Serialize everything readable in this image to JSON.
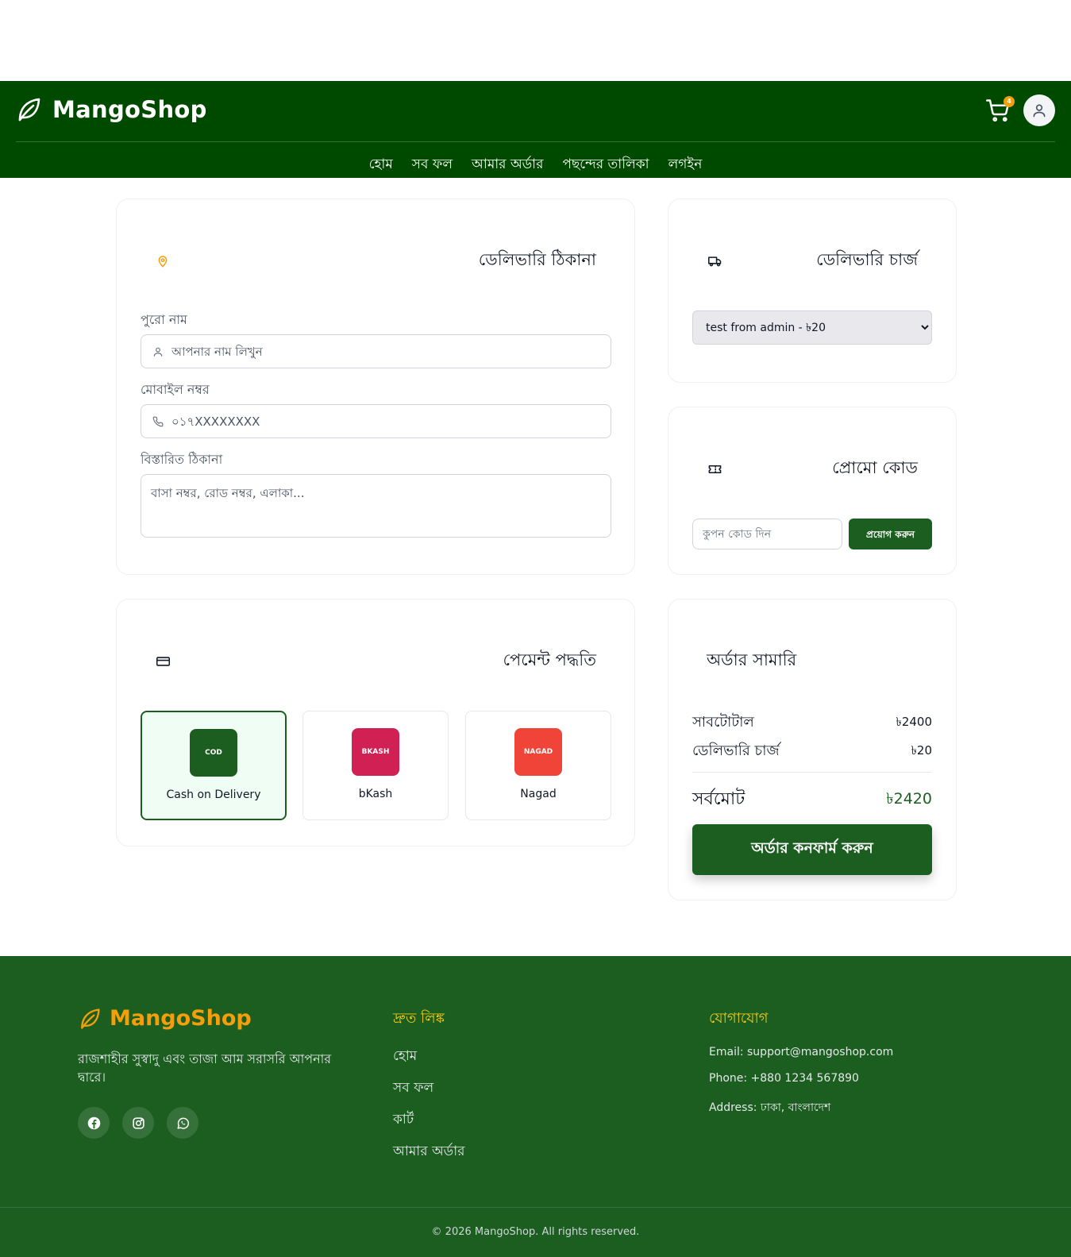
{
  "header": {
    "brand": "MangoShop",
    "cart_count": "4",
    "nav": [
      "হোম",
      "সব ফল",
      "আমার অর্ডার",
      "পছন্দের তালিকা",
      "লগইন"
    ]
  },
  "address": {
    "title": "ডেলিভারি ঠিকানা",
    "name_label": "পুরো নাম",
    "name_placeholder": "আপনার নাম লিখুন",
    "mobile_label": "মোবাইল নম্বর",
    "mobile_placeholder": "০১৭XXXXXXXX",
    "detail_label": "বিস্তারিত ঠিকানা",
    "detail_placeholder": "বাসা নম্বর, রোড নম্বর, এলাকা..."
  },
  "delivery": {
    "title": "ডেলিভারি চার্জ",
    "selected": "test from admin - ৳20"
  },
  "promo": {
    "title": "প্রোমো কোড",
    "placeholder": "কুপন কোড দিন",
    "apply_label": "প্রয়োগ করুন"
  },
  "payment": {
    "title": "পেমেন্ট পদ্ধতি",
    "options": [
      {
        "logo": "COD",
        "name": "Cash on Delivery",
        "color": "#1b5e20",
        "selected": true
      },
      {
        "logo": "BKASH",
        "name": "bKash",
        "color": "#d12053",
        "selected": false
      },
      {
        "logo": "NAGAD",
        "name": "Nagad",
        "color": "#f04438",
        "selected": false
      }
    ]
  },
  "summary": {
    "title": "অর্ডার সামারি",
    "subtotal_label": "সাবটোটাল",
    "subtotal_value": "৳2400",
    "delivery_label": "ডেলিভারি চার্জ",
    "delivery_value": "৳20",
    "total_label": "সর্বমোট",
    "total_value": "৳2420",
    "confirm_label": "অর্ডার কনফার্ম করুন"
  },
  "footer": {
    "brand": "MangoShop",
    "description": "রাজশাহীর সুস্বাদু এবং তাজা আম সরাসরি আপনার দ্বারে।",
    "quick_links_title": "দ্রুত লিঙ্ক",
    "quick_links": [
      "হোম",
      "সব ফল",
      "কার্ট",
      "আমার অর্ডার"
    ],
    "contact_title": "যোগাযোগ",
    "email": "Email: support@mangoshop.com",
    "phone": "Phone: +880 1234 567890",
    "address": "Address: ঢাকা, বাংলাদেশ",
    "copyright": "© 2026 MangoShop. All rights reserved."
  },
  "colors": {
    "header_bg": "#004a00",
    "primary": "#1b5e20",
    "accent": "#f59e0b"
  }
}
